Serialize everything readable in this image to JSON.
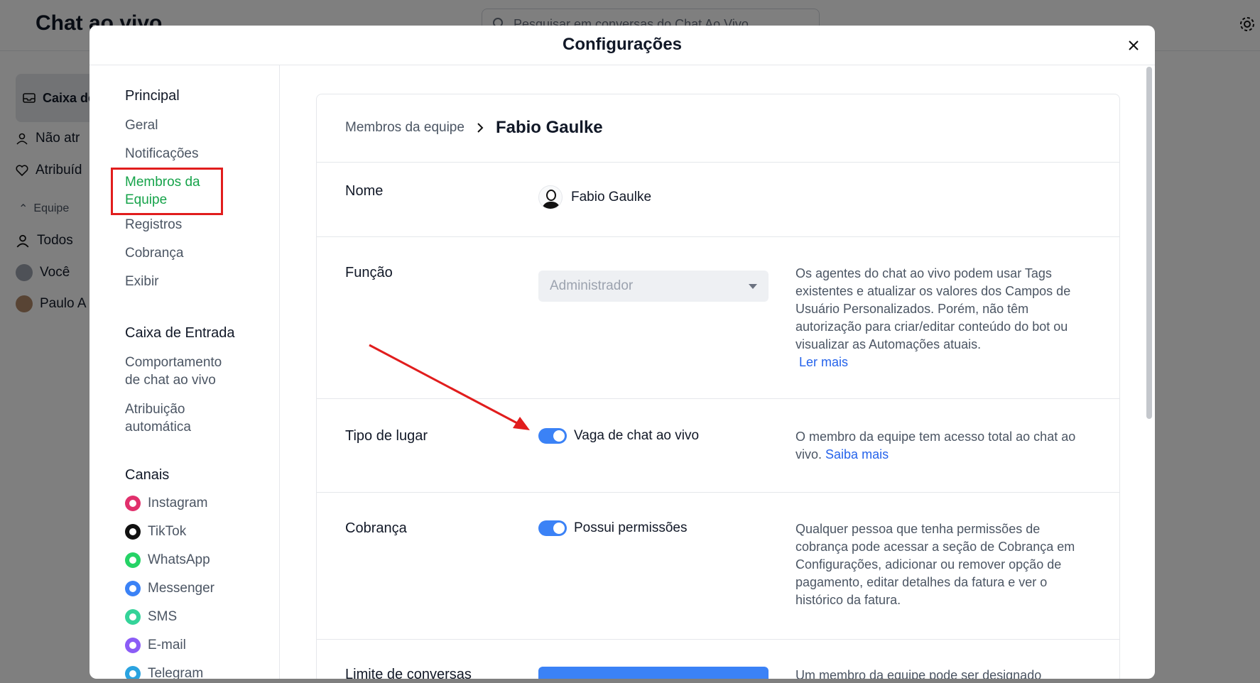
{
  "background": {
    "app_title": "Chat ao vivo",
    "search_placeholder": "Pesquisar em conversas do Chat Ao Vivo",
    "sidebar": {
      "inbox": "Caixa de Entrada",
      "unassigned": "Não atr",
      "assigned": "Atribuíd",
      "team_section": "Equipe",
      "all": "Todos",
      "you": "Você",
      "paulo": "Paulo A"
    }
  },
  "modal": {
    "title": "Configurações",
    "nav": {
      "principal_header": "Principal",
      "principal_items": [
        "Geral",
        "Notificações",
        "Membros da Equipe",
        "Registros",
        "Cobrança",
        "Exibir"
      ],
      "inbox_header": "Caixa de Entrada",
      "inbox_items": [
        "Comportamento de chat ao vivo",
        "Atribuição automática"
      ],
      "channels_header": "Canais",
      "channels": [
        {
          "label": "Instagram",
          "color": "#e1306c"
        },
        {
          "label": "TikTok",
          "color": "#111111"
        },
        {
          "label": "WhatsApp",
          "color": "#25d366"
        },
        {
          "label": "Messenger",
          "color": "#3b82f6"
        },
        {
          "label": "SMS",
          "color": "#34d399"
        },
        {
          "label": "E-mail",
          "color": "#8b5cf6"
        },
        {
          "label": "Telegram",
          "color": "#2aa3e0"
        }
      ]
    },
    "breadcrumb": {
      "parent": "Membros da equipe",
      "current": "Fabio Gaulke"
    },
    "rows": {
      "name": {
        "label": "Nome",
        "value": "Fabio Gaulke"
      },
      "role": {
        "label": "Função",
        "value": "Administrador",
        "description": "Os agentes do chat ao vivo podem usar Tags existentes e atualizar os valores dos Campos de Usuário Personalizados. Porém, não têm autorização para criar/editar conteúdo do bot ou visualizar as Automações atuais.",
        "link": "Ler mais"
      },
      "seat": {
        "label": "Tipo de lugar",
        "toggle_label": "Vaga de chat ao vivo",
        "enabled": true,
        "description": "O membro da equipe tem acesso total ao chat ao vivo.",
        "link": "Saiba mais"
      },
      "billing": {
        "label": "Cobrança",
        "toggle_label": "Possui permissões",
        "enabled": true,
        "description": "Qualquer pessoa que tenha permissões de cobrança pode acessar a seção de Cobrança em Configurações, adicionar ou remover opção de pagamento, editar detalhes da fatura e ver o histórico da fatura."
      },
      "limit": {
        "label": "Limite de conversas",
        "description": "Um membro da equipe pode ser designado"
      }
    }
  },
  "colors": {
    "accent": "#3b82f6",
    "active_nav": "#16a34a",
    "highlight": "#e11d1d",
    "link": "#2563eb"
  }
}
